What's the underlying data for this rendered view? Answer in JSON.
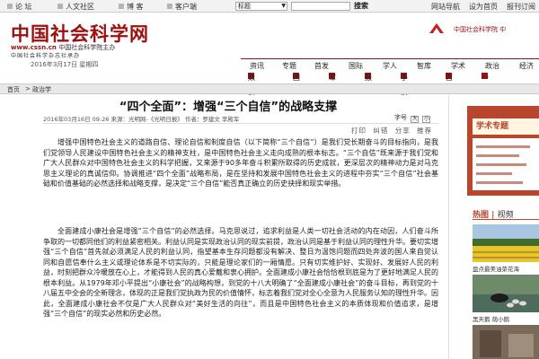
{
  "topbar": {
    "nav": [
      "论 坛",
      "人文社区",
      "博 客",
      "客户端"
    ],
    "search_select": "标题",
    "search_button": "搜索",
    "links": [
      "网站导航",
      "设为首页",
      "报刊订阅"
    ]
  },
  "header": {
    "logo": "中国社会科学网",
    "url": "www.cssn.cn",
    "url_tag": "中国社会科学院主办",
    "subtitle": "中国社会科学杂志社承办",
    "date": "2016年3月17日  星期四",
    "brand_link": "中国社会科学院  中",
    "colors": {
      "brand": "#9b1010",
      "accent": "#b8452e"
    }
  },
  "nav": {
    "main": [
      "资讯",
      "专题",
      "首发",
      "国际",
      "学人",
      "智库",
      "学术",
      "政治",
      "经济"
    ],
    "sub": [
      "数字报",
      "国学",
      "军事",
      "报刊",
      "手机报",
      "百家",
      "一带一路"
    ]
  },
  "breadcrumb": [
    "首页",
    "政治学"
  ],
  "article": {
    "title": "“四个全面”：增强“三个自信”的战略支撑",
    "meta": "2016年03月16日  09:26  来源：光明网-《光明日报》  作者：罗建文  李殿军",
    "font_label": "字号",
    "font_sizes": [
      "大",
      "小"
    ],
    "actions": [
      "打印",
      "纠错",
      "分享",
      "推荐"
    ],
    "paragraphs": [
      "增强中国特色社会主义的道路自信、理论自信和制度自信（以下简称“三个自信”）是我们党长期奋斗的目标指向，是我们党领导人民建设中国特色社会主义的精神支柱，是中国特色社会主义走向成熟的根本标志。“三个自信”既来源于我们党和广大人民群众对中国特色社会主义的科学把握，又来源于90多年奋斗积累所取得的历史成就，更深层次的精神动力是对马克思主义理论的真诚信仰。协调推进“四个全面”战略布局，是在坚持和发展中国特色社会主义的进程中夯实“三个自信”社会基础和价值基础的必然选择和战略支撑，是决定“三个自信”能否真正确立的历史抉择和现实举措。",
      "全面建成小康社会是增强“三个自信”的必然选择。马克思说过，追求利益是人类一切社会活动的内在动因，人们奋斗所争取的一切都同他们的利益紧密相关。利益认同是实现政治认同的现实前提，政治认同是基于利益认同的理性升华。要切实增强“三个自信”首先就必须满足人民的利益认同，指望基本生存问题都没有解决、整日为温饱问题而四处奔波的国人来自觉认同和自愿信奉什么主义或理论体系是不切实际的，只能是理论家们的一厢情愿。只有切实维护好、实现好、发展好人民的利益，时刻把群众冷暖放在心上，才能得到人民的真心爱戴和衷心拥护。全面建成小康社会恰恰根到底是为了更好地满足人民的根本利益。从1979年邓小平提出“小康社会”的战略构想，到党的十八大明确了“全面建成小康社会”的奋斗目标，再到党的十八届五中全会的全新理念，体现的正是我们党执政为民的价值情怀，标志着我们党对全心全意为人民服务认知的理性升华。因此，全面建成小康社会不仅是广大人民群众对“美好生活的向往”，而且是中国特色社会主义的本质体现和价值追求，是增强“三个自信”的现实必然和历史必然。"
    ]
  },
  "sidebar": {
    "ad_title": "学术专题",
    "hot": "热图",
    "hot_sub": "视频",
    "captions": [
      "盘点最美油菜花海",
      "黑天鹅  萌小鹅"
    ]
  }
}
